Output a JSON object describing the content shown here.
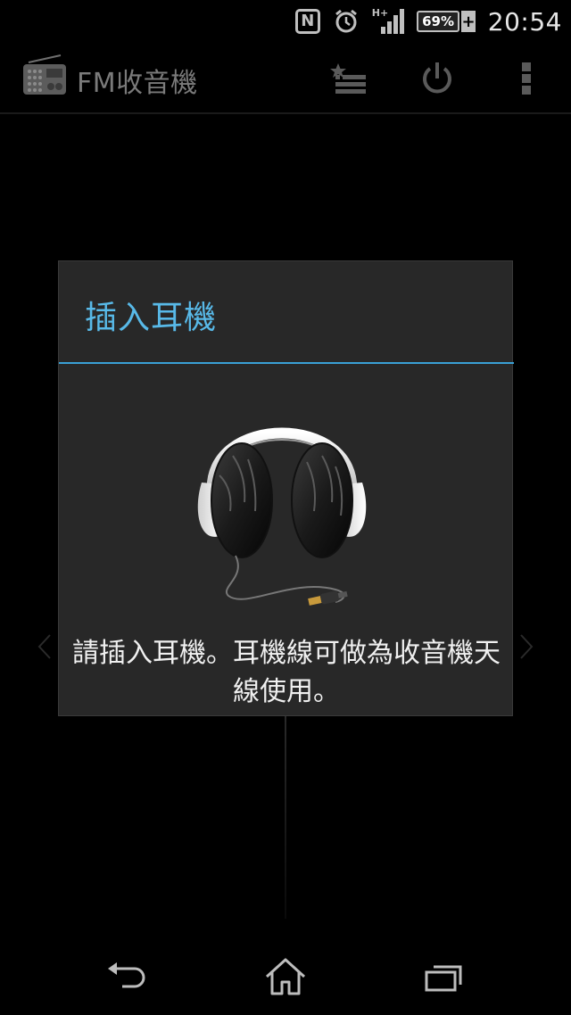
{
  "status_bar": {
    "nfc_label": "N",
    "network_label": "H+",
    "battery_percent": "69%",
    "time": "20:54",
    "icons": [
      "nfc-icon",
      "alarm-icon",
      "signal-icon",
      "battery-icon"
    ]
  },
  "action_bar": {
    "title": "FM收音機",
    "icons": [
      "radio-app-icon",
      "favorites-list-icon",
      "power-icon",
      "overflow-menu-icon"
    ]
  },
  "dialog": {
    "title": "插入耳機",
    "message": "請插入耳機。耳機線可做為收音機天線使用。",
    "illustration_icon": "headphones-icon",
    "accent_color": "#3aa1d6",
    "title_color": "#58b9e8"
  },
  "nav_bar": {
    "icons": [
      "back-icon",
      "home-icon",
      "recent-apps-icon"
    ]
  }
}
